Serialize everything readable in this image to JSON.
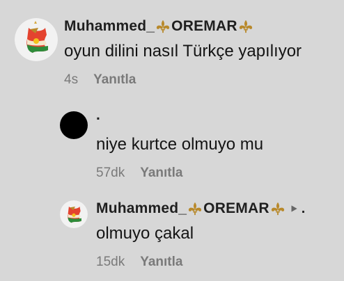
{
  "comments": [
    {
      "username": "Muhammed_",
      "username_suffix": "OREMAR",
      "text": "oyun dilini nasıl Türkçe yapılıyor",
      "time": "4s",
      "reply_label": "Yanıtla"
    },
    {
      "username": ".",
      "text": "niye kurtce olmuyo mu",
      "time": "57dk",
      "reply_label": "Yanıtla"
    },
    {
      "username": "Muhammed_",
      "username_suffix": "OREMAR",
      "reply_to": ".",
      "text": "olmuyo çakal",
      "time": "15dk",
      "reply_label": "Yanıtla"
    }
  ],
  "colors": {
    "background": "#d7d7d7",
    "fleur_gold": "#b8892b",
    "meta_gray": "#7a7a7a"
  },
  "icons": [
    "fleur-de-lis-icon",
    "reply-arrow-icon",
    "kurdistan-flag-avatar"
  ]
}
